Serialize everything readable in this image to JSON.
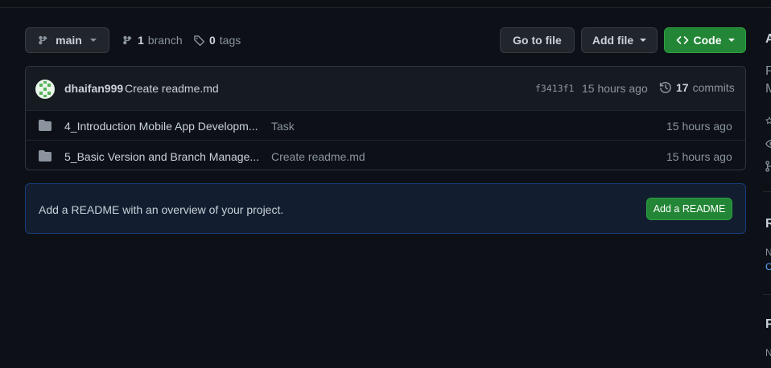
{
  "branch_selector": {
    "label": "main"
  },
  "stats": {
    "branch_count": "1",
    "branch_label": "branch",
    "tag_count": "0",
    "tag_label": "tags"
  },
  "actions": {
    "go_to_file": "Go to file",
    "add_file": "Add file",
    "code": "Code"
  },
  "latest_commit": {
    "author": "dhaifan999",
    "message": "Create readme.md",
    "hash": "f3413f1",
    "time": "15 hours ago",
    "commit_count": "17",
    "commit_label": "commits"
  },
  "files": [
    {
      "name": "4_Introduction Mobile App Developm...",
      "message": "Task",
      "time": "15 hours ago"
    },
    {
      "name": "5_Basic Version and Branch Manage...",
      "message": "Create readme.md",
      "time": "15 hours ago"
    }
  ],
  "readme_banner": {
    "text": "Add a README with an overview of your project.",
    "button": "Add a README"
  },
  "sidebar_fragments": {
    "heading_a": "A",
    "line_p": "P",
    "line_m": "M",
    "heading_r": "R",
    "line_n1": "N",
    "link_c": "C",
    "heading_p": "P",
    "line_n2": "N"
  },
  "colors": {
    "background": "#0d1117",
    "green": "#238636",
    "link": "#58a6ff"
  }
}
